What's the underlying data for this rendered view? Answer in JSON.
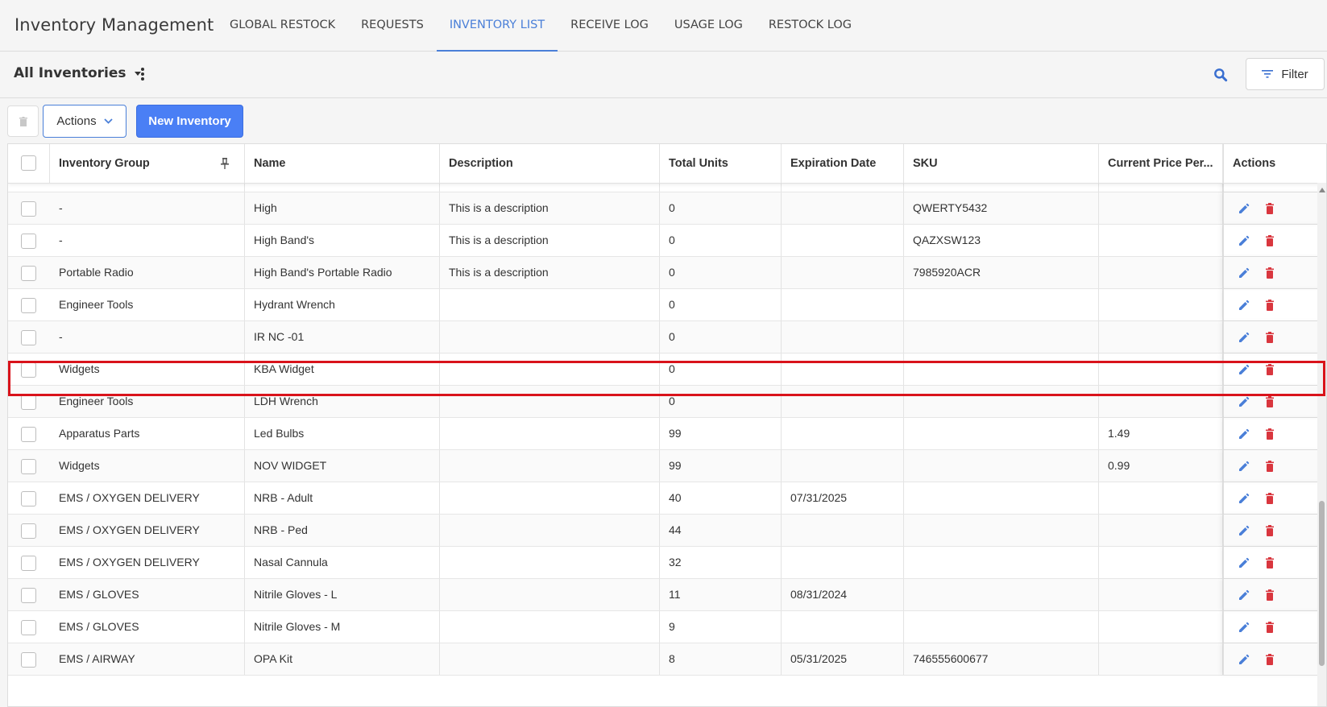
{
  "app": {
    "title": "Inventory Management"
  },
  "nav": {
    "tabs": [
      {
        "label": "GLOBAL RESTOCK",
        "active": false
      },
      {
        "label": "REQUESTS",
        "active": false
      },
      {
        "label": "INVENTORY LIST",
        "active": true
      },
      {
        "label": "RECEIVE LOG",
        "active": false
      },
      {
        "label": "USAGE LOG",
        "active": false
      },
      {
        "label": "RESTOCK LOG",
        "active": false
      }
    ]
  },
  "subbar": {
    "inventory_selector": "All Inventories",
    "filter_label": "Filter"
  },
  "toolbar": {
    "actions_label": "Actions",
    "new_inventory_label": "New Inventory"
  },
  "grid": {
    "columns": [
      "Inventory Group",
      "Name",
      "Description",
      "Total Units",
      "Expiration Date",
      "SKU",
      "Current Price Per...",
      "Actions"
    ],
    "rows": [
      {
        "group": "-",
        "name": "High",
        "description": "This is a description",
        "units": "0",
        "expiration": "",
        "sku": "QWERTY5432",
        "price": ""
      },
      {
        "group": "-",
        "name": "High Band's",
        "description": "This is a description",
        "units": "0",
        "expiration": "",
        "sku": "QAZXSW123",
        "price": ""
      },
      {
        "group": "Portable Radio",
        "name": "High Band's Portable Radio",
        "description": "This is a description",
        "units": "0",
        "expiration": "",
        "sku": "7985920ACR",
        "price": ""
      },
      {
        "group": "Engineer Tools",
        "name": "Hydrant Wrench",
        "description": "",
        "units": "0",
        "expiration": "",
        "sku": "",
        "price": ""
      },
      {
        "group": "-",
        "name": "IR NC -01",
        "description": "",
        "units": "0",
        "expiration": "",
        "sku": "",
        "price": ""
      },
      {
        "group": "Widgets",
        "name": "KBA Widget",
        "description": "",
        "units": "0",
        "expiration": "",
        "sku": "",
        "price": ""
      },
      {
        "group": "Engineer Tools",
        "name": "LDH Wrench",
        "description": "",
        "units": "0",
        "expiration": "",
        "sku": "",
        "price": ""
      },
      {
        "group": "Apparatus Parts",
        "name": "Led Bulbs",
        "description": "",
        "units": "99",
        "expiration": "",
        "sku": "",
        "price": "1.49"
      },
      {
        "group": "Widgets",
        "name": "NOV WIDGET",
        "description": "",
        "units": "99",
        "expiration": "",
        "sku": "",
        "price": "0.99"
      },
      {
        "group": "EMS / OXYGEN DELIVERY",
        "name": "NRB - Adult",
        "description": "",
        "units": "40",
        "expiration": "07/31/2025",
        "sku": "",
        "price": ""
      },
      {
        "group": "EMS / OXYGEN DELIVERY",
        "name": "NRB - Ped",
        "description": "",
        "units": "44",
        "expiration": "",
        "sku": "",
        "price": ""
      },
      {
        "group": "EMS / OXYGEN DELIVERY",
        "name": "Nasal Cannula",
        "description": "",
        "units": "32",
        "expiration": "",
        "sku": "",
        "price": ""
      },
      {
        "group": "EMS / GLOVES",
        "name": "Nitrile Gloves - L",
        "description": "",
        "units": "11",
        "expiration": "08/31/2024",
        "sku": "",
        "price": ""
      },
      {
        "group": "EMS / GLOVES",
        "name": "Nitrile Gloves - M",
        "description": "",
        "units": "9",
        "expiration": "",
        "sku": "",
        "price": ""
      },
      {
        "group": "EMS / AIRWAY",
        "name": "OPA Kit",
        "description": "",
        "units": "8",
        "expiration": "05/31/2025",
        "sku": "746555600677",
        "price": ""
      }
    ]
  },
  "colors": {
    "accent": "#4a7fd8",
    "primary_button": "#4a7ff5",
    "delete": "#d9363e",
    "highlight": "#d9131b"
  }
}
